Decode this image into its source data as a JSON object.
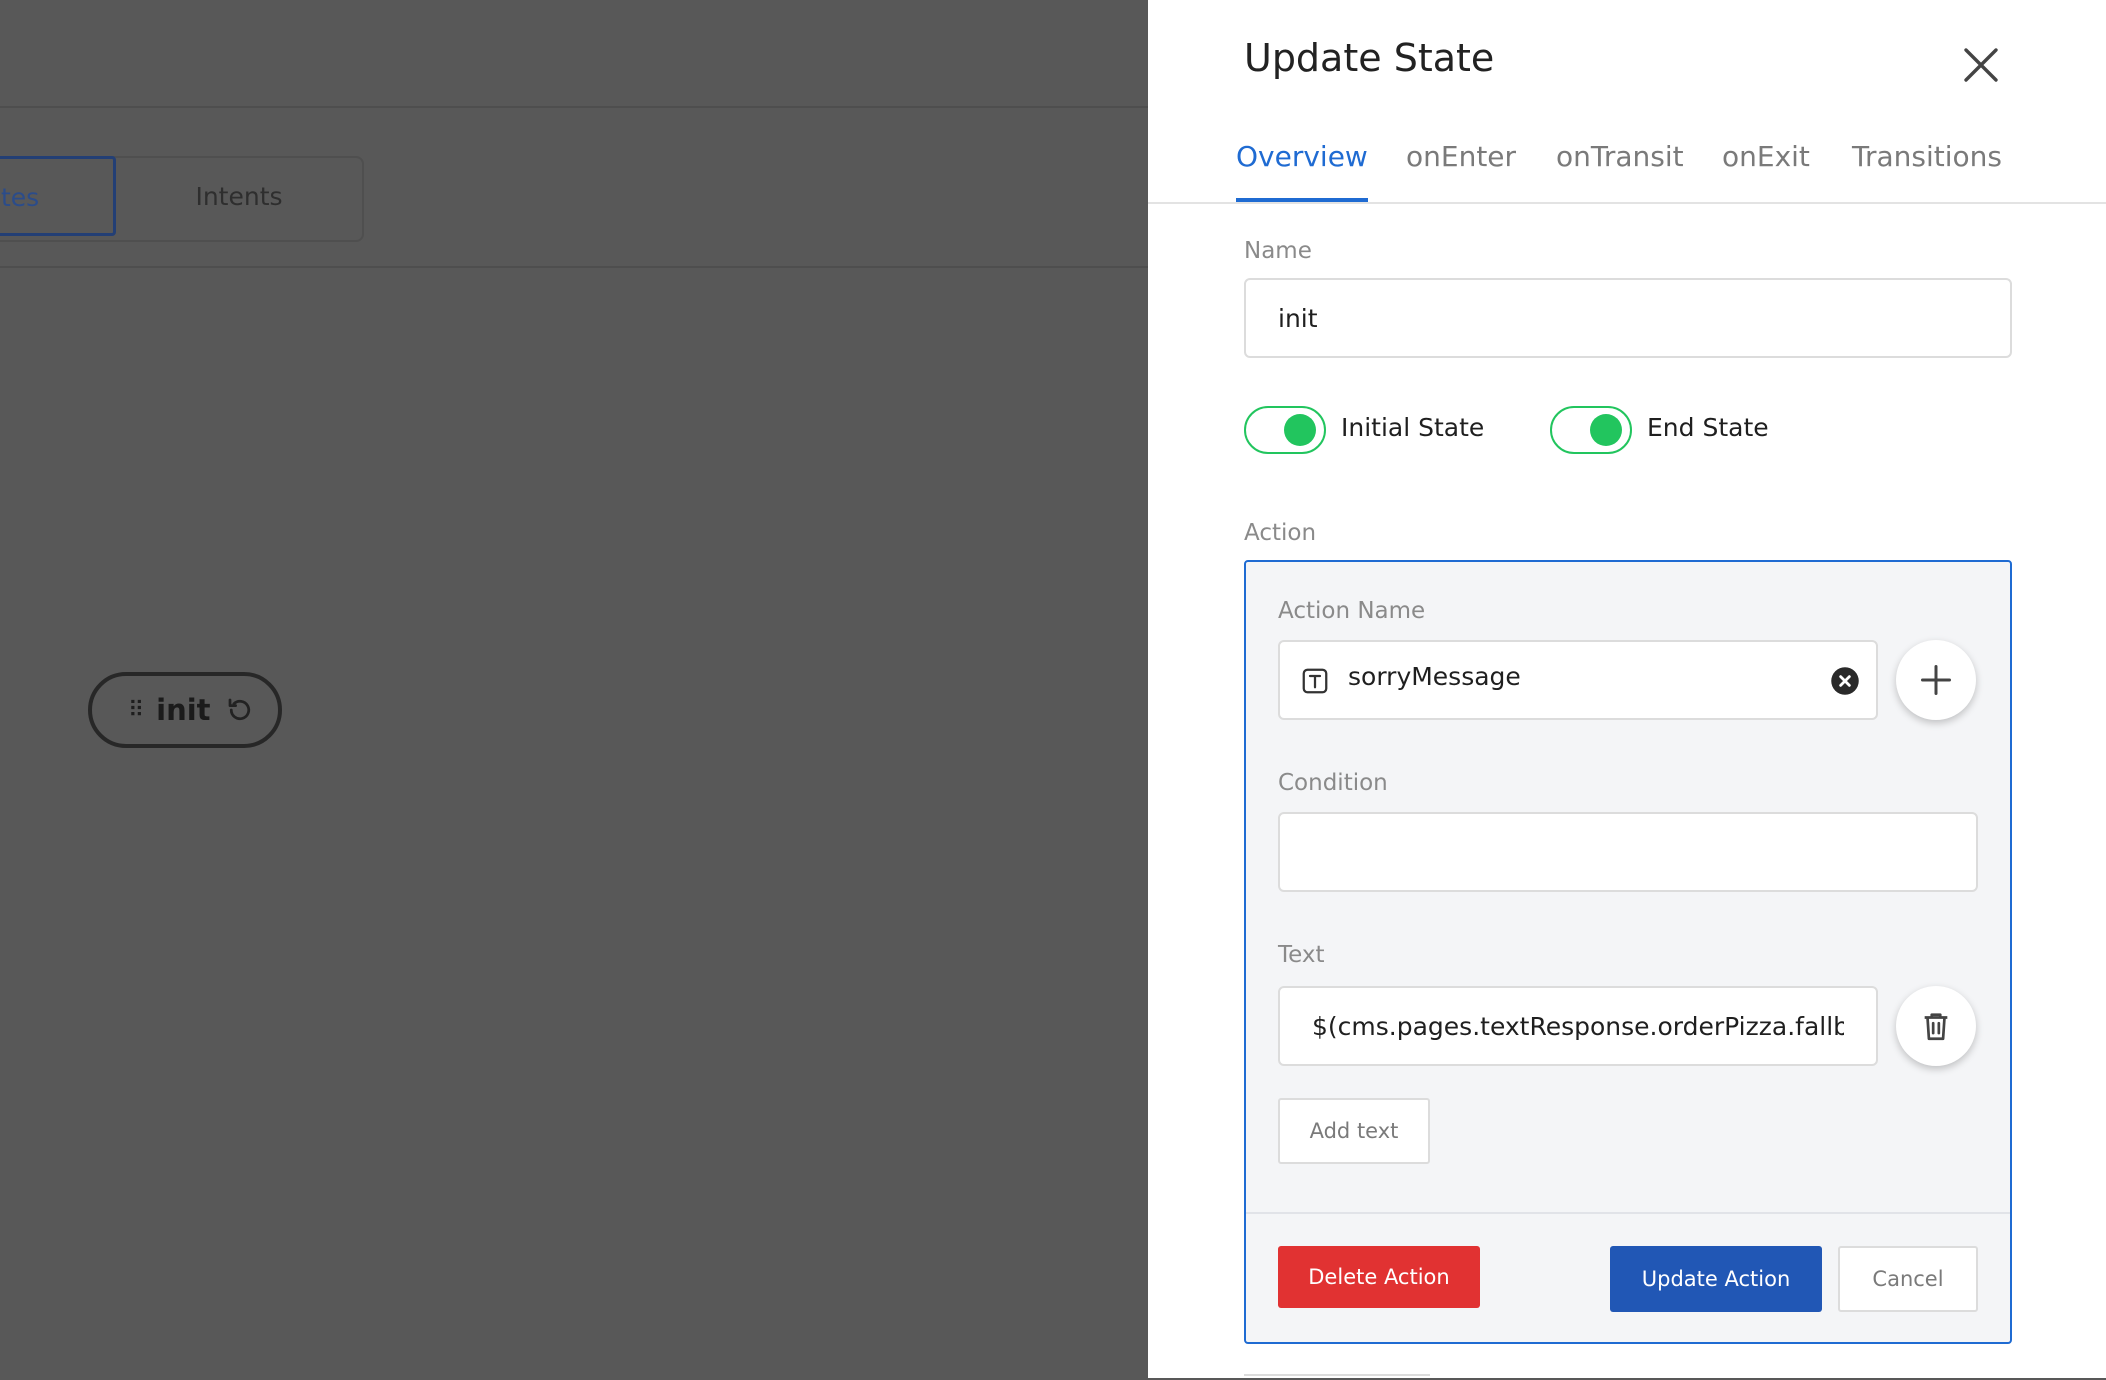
{
  "background": {
    "tabs": {
      "states_partial_label": "tes",
      "intents_label": "Intents"
    },
    "node": {
      "label": "init",
      "grip_icon": "drag-handle-icon",
      "reset_icon": "reset-icon"
    }
  },
  "panel": {
    "title": "Update State",
    "close_icon": "close-icon",
    "tabs": [
      {
        "label": "Overview",
        "active": true
      },
      {
        "label": "onEnter",
        "active": false
      },
      {
        "label": "onTransit",
        "active": false
      },
      {
        "label": "onExit",
        "active": false
      },
      {
        "label": "Transitions",
        "active": false
      }
    ],
    "name": {
      "label": "Name",
      "value": "init"
    },
    "toggles": {
      "initial_state": {
        "label": "Initial State",
        "on": true
      },
      "end_state": {
        "label": "End State",
        "on": true
      }
    },
    "action": {
      "section_label": "Action",
      "action_name": {
        "label": "Action Name",
        "value": "sorryMessage",
        "type_icon": "text-type-icon",
        "clear_icon": "clear-icon"
      },
      "add_icon": "plus-icon",
      "condition": {
        "label": "Condition",
        "value": ""
      },
      "text": {
        "label": "Text",
        "value": "$(cms.pages.textResponse.orderPizza.fallback",
        "delete_icon": "trash-icon"
      },
      "add_text_label": "Add text",
      "delete_action_label": "Delete Action",
      "update_action_label": "Update Action",
      "cancel_label": "Cancel"
    }
  },
  "colors": {
    "accent": "#1f6bd2",
    "toggle_on": "#22c55e",
    "danger": "#e13232",
    "primary_button": "#2157b5",
    "overlay": "#585858"
  }
}
